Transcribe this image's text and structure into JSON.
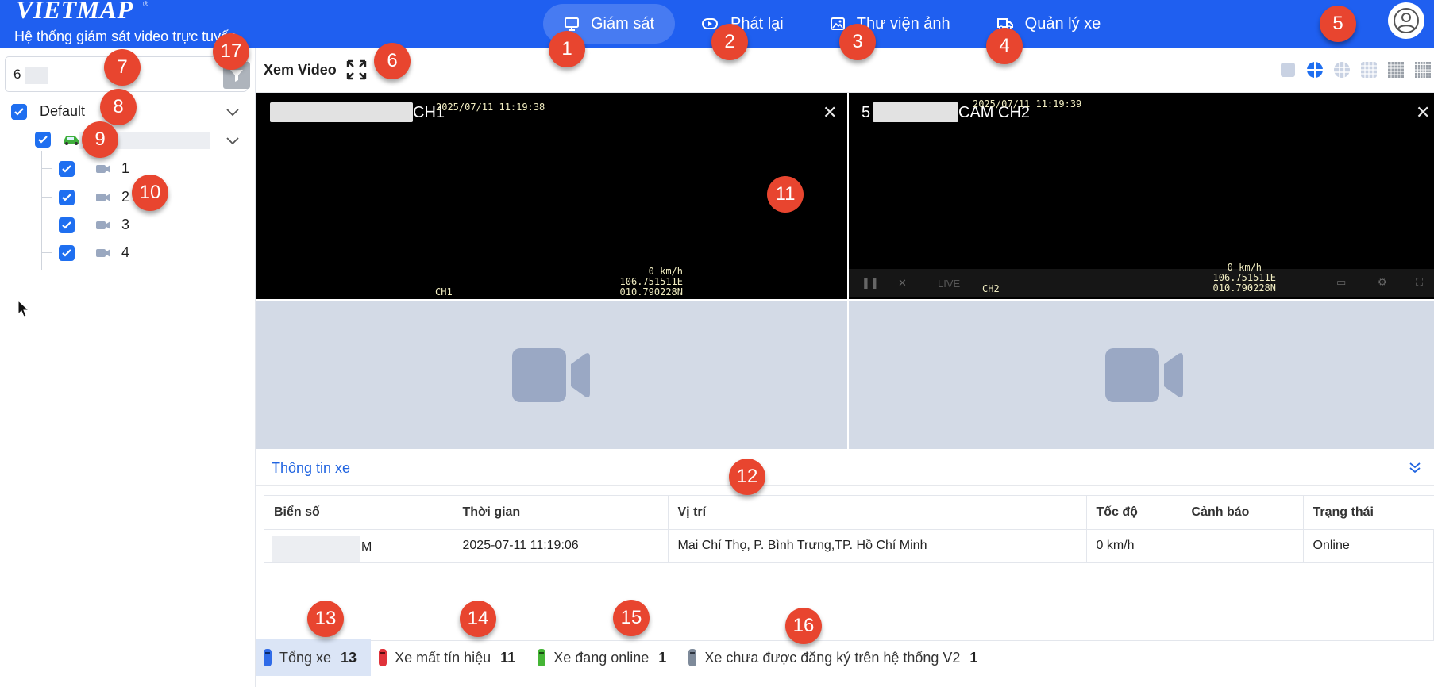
{
  "app": {
    "logo": "VIETMAP",
    "logo_mark": "®",
    "subtitle": "Hệ thống giám sát video trực tuyến"
  },
  "nav": {
    "monitor": "Giám sát",
    "playback": "Phát lại",
    "gallery": "Thư viện ảnh",
    "vehicles": "Quản lý xe"
  },
  "sidebar": {
    "search_value": "6",
    "group_label": "Default",
    "channels": [
      "1",
      "2",
      "3",
      "4"
    ]
  },
  "toolbar": {
    "title": "Xem Video"
  },
  "video": {
    "tile1": {
      "name_prefix": "",
      "name_suffix": "CH1",
      "timestamp": "2025/07/11 11:19:38",
      "speed": "0 km/h",
      "lon": "106.751511E",
      "lat": "010.790228N",
      "channel": "CH1"
    },
    "tile2": {
      "name_prefix": "5",
      "name_suffix": "CAM CH2",
      "timestamp": "2025/07/11 11:19:39",
      "speed": "0 km/h",
      "lon": "106.751511E",
      "lat": "010.790228N",
      "channel": "CH2",
      "live_label": "LIVE"
    }
  },
  "info": {
    "title": "Thông tin xe",
    "columns": [
      "Biển số",
      "Thời gian",
      "Vị trí",
      "Tốc độ",
      "Cảnh báo",
      "Trạng thái"
    ],
    "rows": [
      {
        "plate_suffix": "M",
        "time": "2025-07-11 11:19:06",
        "location": "Mai Chí Thọ, P. Bình Trưng,TP. Hồ Chí Minh",
        "speed": "0 km/h",
        "warning": "",
        "status": "Online"
      }
    ]
  },
  "status_bar": {
    "total": {
      "label": "Tổng xe",
      "count": "13",
      "color": "#2f6be8"
    },
    "lost": {
      "label": "Xe mất tín hiệu",
      "count": "11",
      "color": "#e0323a"
    },
    "online": {
      "label": "Xe đang online",
      "count": "1",
      "color": "#45b536"
    },
    "unregistered": {
      "label": "Xe chưa được đăng ký trên hệ thống V2",
      "count": "1",
      "color": "#7e8a9a"
    }
  },
  "badges": [
    "1",
    "2",
    "3",
    "4",
    "5",
    "6",
    "7",
    "8",
    "9",
    "10",
    "11",
    "12",
    "13",
    "14",
    "15",
    "16",
    "17"
  ],
  "colors": {
    "header": "#1f5ff0",
    "accent": "#1f6ff0",
    "badge": "#e8452f",
    "empty_tile": "#d3dae6"
  }
}
